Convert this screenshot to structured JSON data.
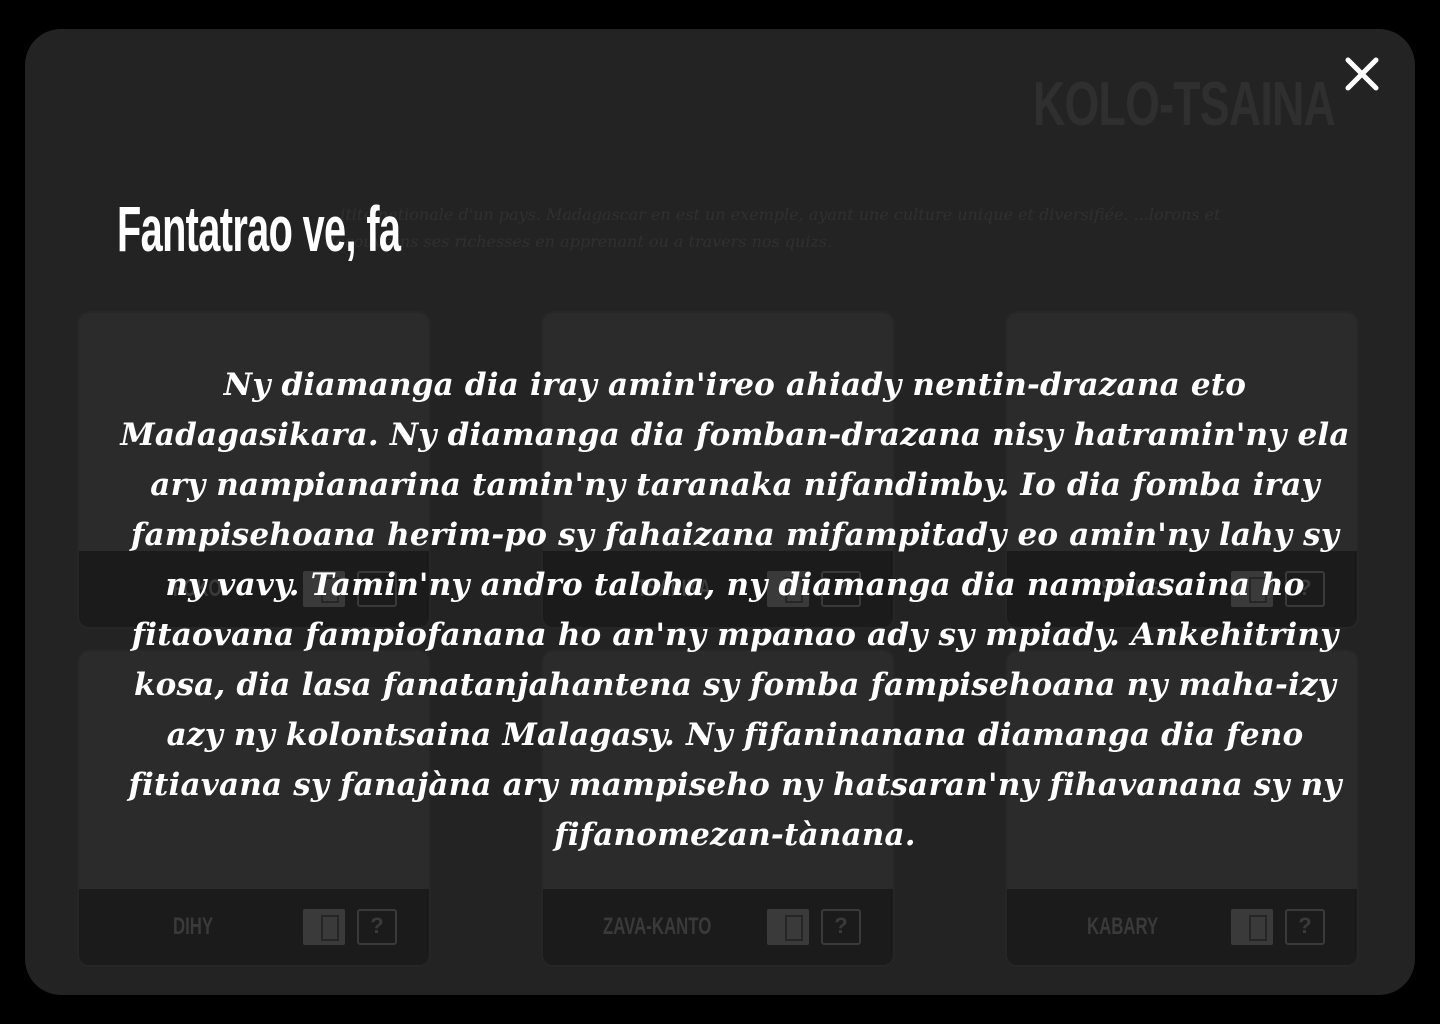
{
  "background": {
    "page_title": "KOLO-TSAINA",
    "intro": "...itité nationale d'un pays. Madagascar en est un exemple, ayant une culture unique et diversifiée. ...lorons et découvrons ses richesses en apprenant ou a travers nos quizs.",
    "cards": [
      {
        "label": "FOKO"
      },
      {
        "label": "TSAPIKA"
      },
      {
        "label": "SALEGY"
      },
      {
        "label": "DIHY"
      },
      {
        "label": "ZAVA-KANTO"
      },
      {
        "label": "KABARY"
      }
    ]
  },
  "modal": {
    "title": "Fantatrao ve, fa",
    "body": "Ny diamanga dia iray amin'ireo ahiady nentin-drazana eto Madagasikara. Ny diamanga dia fomban-drazana nisy hatramin'ny ela ary nampianarina tamin'ny taranaka nifandimby. Io dia fomba iray fampisehoana herim-po sy fahaizana mifampitady eo amin'ny lahy sy ny vavy. Tamin'ny andro taloha, ny diamanga dia nampiasaina ho fitaovana fampiofanana ho an'ny mpanao ady sy mpiady. Ankehitriny kosa, dia lasa fanatanjahantena sy fomba fampisehoana ny maha-izy azy ny kolontsaina Malagasy. Ny fifaninanana diamanga dia feno fitiavana sy fanajàna ary mampiseho ny hatsaran'ny fihavanana sy ny fifanomezan-tànana.",
    "close_icon": "close-icon"
  }
}
